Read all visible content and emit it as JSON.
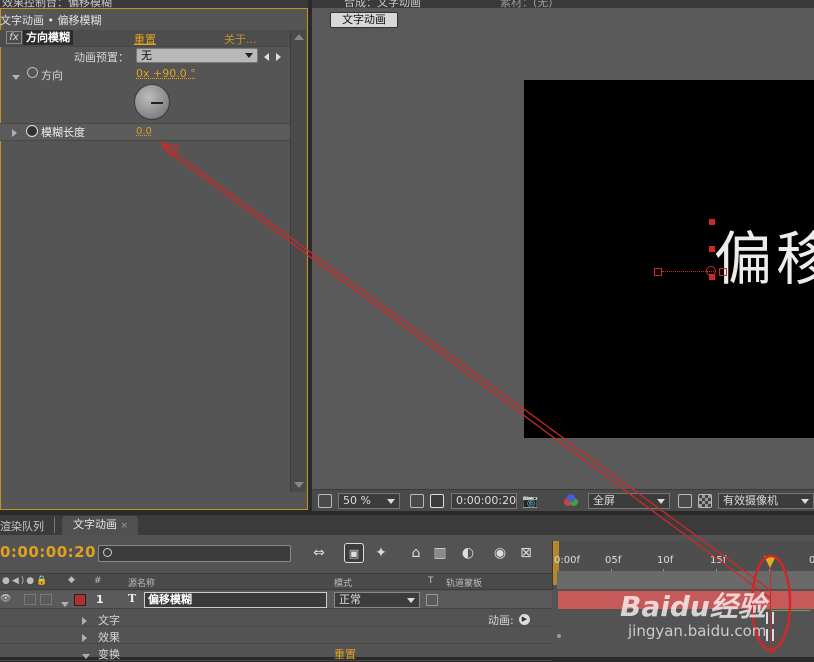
{
  "left_panel": {
    "tabs": [
      "效果控制台：偏移模糊"
    ],
    "header": "文字动画 • 偏移模糊",
    "effect_name": "方向模糊",
    "reset_label": "重置",
    "about_label": "关于...",
    "preset_label": "动画预置：",
    "preset_value": "无",
    "direction_label": "方向",
    "direction_value": "0x +90.0 °",
    "blur_length_label": "模糊长度",
    "blur_length_value": "0.0"
  },
  "viewer": {
    "tabs": [
      "合成：文字动画",
      "素材：(无)"
    ],
    "comp_tab": "文字动画",
    "comp_text": "偏移",
    "zoom": "50 %",
    "timecode": "0:00:00:20",
    "resolution": "全屏",
    "camera": "有效摄像机"
  },
  "timeline": {
    "tabs": [
      "渲染队列",
      "文字动画"
    ],
    "current_time": "0:00:00:20",
    "columns": {
      "number": "#",
      "source_name": "源名称",
      "mode": "模式",
      "t": "T",
      "track_matte": "轨道蒙板"
    },
    "layer": {
      "index": "1",
      "type_icon": "T",
      "name": "偏移模糊",
      "mode": "正常"
    },
    "sub_rows": [
      {
        "label": "文字",
        "right": "动画:"
      },
      {
        "label": "效果",
        "right": ""
      },
      {
        "label": "变换",
        "right": "重置"
      }
    ],
    "ruler_labels": [
      "0:00f",
      "05f",
      "10f",
      "15f",
      "0"
    ]
  },
  "watermark": {
    "brand": "Baidu经验",
    "url": "jingyan.baidu.com"
  },
  "colors": {
    "accent_gold": "#e0a020",
    "annotation_red": "#d02828",
    "layer_bar": "#c65a5a"
  }
}
